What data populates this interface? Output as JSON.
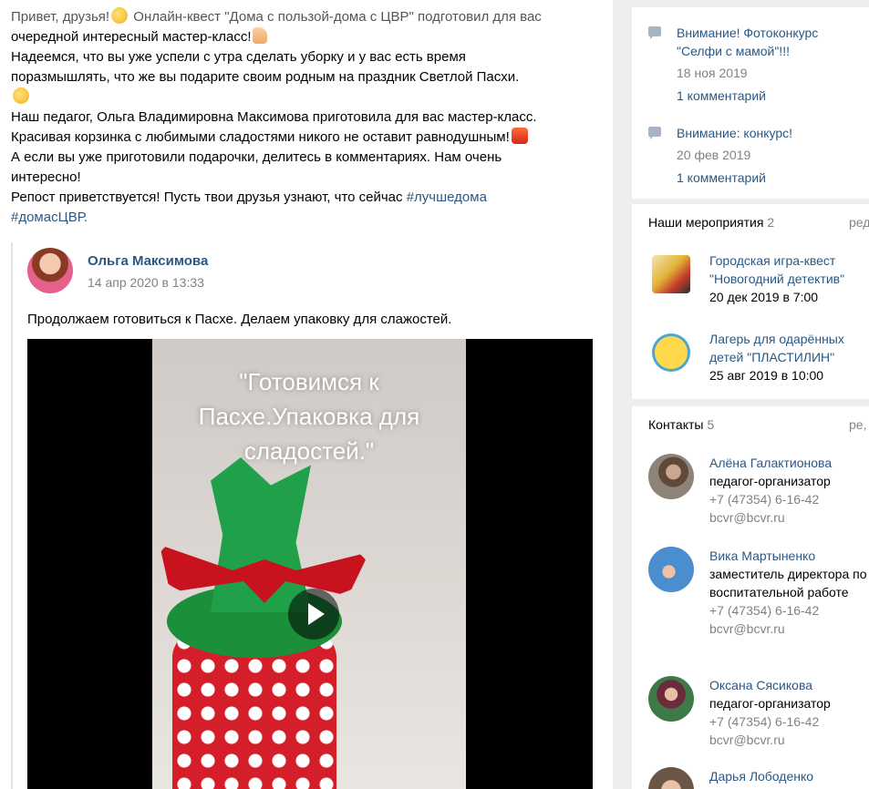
{
  "post": {
    "lines": [
      {
        "text": "Привет, друзья!",
        "emoji": "yellow",
        "rest": " Онлайн-квест \"Дома с пользой-дома с ЦВР\" подготовил для вас"
      },
      {
        "text": "очередной интересный мастер-класс!",
        "emoji": "thumb"
      },
      {
        "text": "Надеемся, что вы уже успели с утра сделать уборку и у вас есть время"
      },
      {
        "text": "поразмышлять, что же вы подарите своим родным на праздник Светлой Пасхи."
      },
      {
        "emoji_only": "yellow"
      },
      {
        "text": "Наш педагог, Ольга Владимировна Максимова приготовила для вас мастер-класс."
      },
      {
        "text": "Красивая корзинка с любимыми сладостями никого не оставит равнодушным!",
        "emoji": "basket"
      },
      {
        "text": "А если вы уже приготовили подарочки, делитесь в комментариях. Нам очень"
      },
      {
        "text": "интересно!"
      },
      {
        "text": "Репост приветствуется! Пусть твои друзья узнают, что сейчас ",
        "link": "#лучшедома"
      }
    ],
    "hashtag_last": "#домасЦВР."
  },
  "repost": {
    "author": "Ольга Максимова",
    "date": "14 апр 2020 в 13:33",
    "text": "Продолжаем готовиться к Пасхе. Делаем упаковку для слажостей.",
    "video_title_lines": [
      "\"Готовимся к",
      "Пасхе.Упаковка для",
      "сладостей.\""
    ]
  },
  "sidebar": {
    "topics": [
      {
        "title": "Внимание! Фотоконкурс \"Селфи с мамой\"!!!",
        "date": "18 ноя 2019",
        "comments": "1 комментарий"
      },
      {
        "title": "Внимание: конкурс!",
        "date": "20 фев 2019",
        "comments": "1 комментарий"
      }
    ],
    "events_header": "Наши мероприятия",
    "events_count": "2",
    "events_edit": "ред",
    "events": [
      {
        "title": "Городская игра-квест \"Новогодний детектив\"",
        "date": "20 дек 2019 в 7:00"
      },
      {
        "title": "Лагерь для одарённых детей \"ПЛАСТИЛИН\"",
        "date": "25 авг 2019 в 10:00"
      }
    ],
    "contacts_header": "Контакты",
    "contacts_count": "5",
    "contacts_edit": "ре,",
    "contacts": [
      {
        "name": "Алёна Галактионова",
        "role": "педагог-организатор",
        "phone": "+7 (47354) 6-16-42",
        "email": "bcvr@bcvr.ru"
      },
      {
        "name": "Вика Мартыненко",
        "role": "заместитель директора по воспитательной работе",
        "phone": "+7 (47354) 6-16-42",
        "email": "bcvr@bcvr.ru"
      },
      {
        "name": "Оксана Сясикова",
        "role": "педагог-организатор",
        "phone": "+7 (47354) 6-16-42",
        "email": "bcvr@bcvr.ru"
      },
      {
        "name": "Дарья Лободенко"
      }
    ]
  }
}
